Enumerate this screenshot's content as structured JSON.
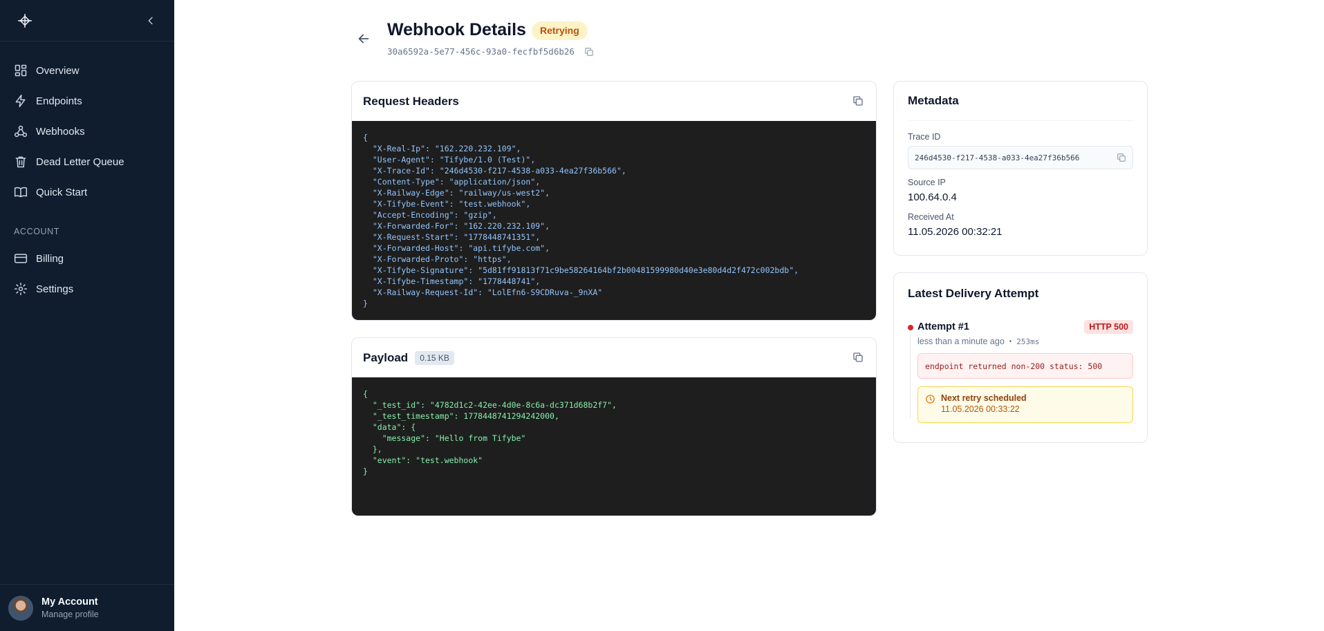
{
  "sidebar": {
    "nav": [
      {
        "label": "Overview",
        "icon": "overview-icon"
      },
      {
        "label": "Endpoints",
        "icon": "endpoints-icon"
      },
      {
        "label": "Webhooks",
        "icon": "webhooks-icon"
      },
      {
        "label": "Dead Letter Queue",
        "icon": "trash-icon"
      },
      {
        "label": "Quick Start",
        "icon": "book-icon"
      }
    ],
    "section_label": "ACCOUNT",
    "account_nav": [
      {
        "label": "Billing",
        "icon": "credit-card-icon"
      },
      {
        "label": "Settings",
        "icon": "gear-icon"
      }
    ],
    "account": {
      "name": "My Account",
      "subtitle": "Manage profile"
    }
  },
  "header": {
    "title": "Webhook Details",
    "status": "Retrying",
    "webhook_id": "30a6592a-5e77-456c-93a0-fecfbf5d6b26"
  },
  "request_headers": {
    "title": "Request Headers",
    "code": "{\n  \"X-Real-Ip\": \"162.220.232.109\",\n  \"User-Agent\": \"Tifybe/1.0 (Test)\",\n  \"X-Trace-Id\": \"246d4530-f217-4538-a033-4ea27f36b566\",\n  \"Content-Type\": \"application/json\",\n  \"X-Railway-Edge\": \"railway/us-west2\",\n  \"X-Tifybe-Event\": \"test.webhook\",\n  \"Accept-Encoding\": \"gzip\",\n  \"X-Forwarded-For\": \"162.220.232.109\",\n  \"X-Request-Start\": \"1778448741351\",\n  \"X-Forwarded-Host\": \"api.tifybe.com\",\n  \"X-Forwarded-Proto\": \"https\",\n  \"X-Tifybe-Signature\": \"5d81ff91813f71c9be58264164bf2b00481599980d40e3e80d4d2f472c002bdb\",\n  \"X-Tifybe-Timestamp\": \"1778448741\",\n  \"X-Railway-Request-Id\": \"LolEfn6-S9CDRuva-_9nXA\"\n}"
  },
  "payload": {
    "title": "Payload",
    "size": "0.15 KB",
    "code": "{\n  \"_test_id\": \"4782d1c2-42ee-4d0e-8c6a-dc371d68b2f7\",\n  \"_test_timestamp\": 1778448741294242000,\n  \"data\": {\n    \"message\": \"Hello from Tifybe\"\n  },\n  \"event\": \"test.webhook\"\n}"
  },
  "metadata": {
    "title": "Metadata",
    "trace_label": "Trace ID",
    "trace_id": "246d4530-f217-4538-a033-4ea27f36b566",
    "source_ip_label": "Source IP",
    "source_ip": "100.64.0.4",
    "received_label": "Received At",
    "received_at": "11.05.2026 00:32:21"
  },
  "delivery": {
    "title": "Latest Delivery Attempt",
    "attempt": "Attempt #1",
    "http_status": "HTTP 500",
    "time_ago": "less than a minute ago",
    "duration": "253ms",
    "error": "endpoint returned non-200 status: 500",
    "retry_title": "Next retry scheduled",
    "retry_time": "11.05.2026 00:33:22"
  },
  "colors": {
    "sidebar_bg": "#0f1d2e",
    "retry_badge_bg": "#fef3c7",
    "retry_badge_text": "#b45309",
    "error_red": "#dc2626",
    "code_bg": "#1e1e1e"
  }
}
